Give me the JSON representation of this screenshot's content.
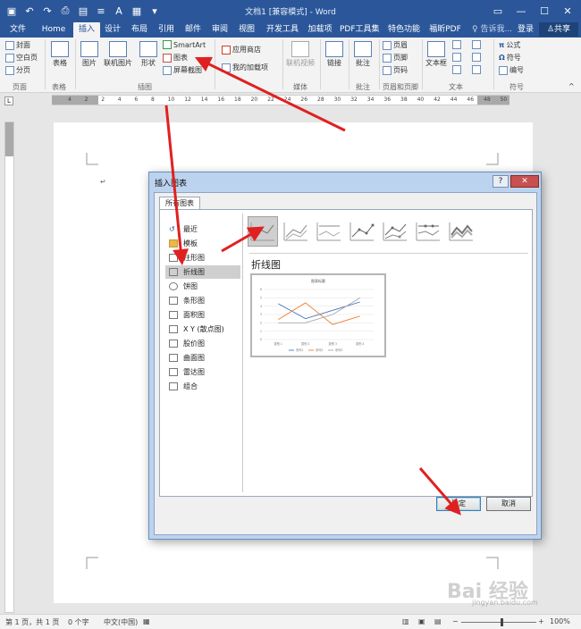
{
  "window": {
    "title": "文档1 [兼容模式] - Word"
  },
  "tabs": [
    {
      "label": "文件"
    },
    {
      "label": "Home"
    },
    {
      "label": "插入"
    },
    {
      "label": "设计"
    },
    {
      "label": "布局"
    },
    {
      "label": "引用"
    },
    {
      "label": "邮件"
    },
    {
      "label": "审阅"
    },
    {
      "label": "视图"
    },
    {
      "label": "开发工具"
    },
    {
      "label": "加载项"
    },
    {
      "label": "PDF工具集"
    },
    {
      "label": "特色功能"
    },
    {
      "label": "福昕PDF"
    }
  ],
  "tell_me": "告诉我...",
  "login": "登录",
  "share": "共享",
  "ribbon": {
    "cover": "封面",
    "blank": "空白页",
    "pagebreak": "分页",
    "table": "表格",
    "picture": "图片",
    "online_picture": "联机图片",
    "shapes": "形状",
    "smartart": "SmartArt",
    "chart": "图表",
    "screenshot": "屏幕截图",
    "store": "应用商店",
    "myaddins": "我的加载项",
    "online_video": "联机视频",
    "link": "链接",
    "comment": "批注",
    "header": "页眉",
    "footer": "页脚",
    "pagenum": "页码",
    "textbox": "文本框",
    "equation": "公式",
    "symbol": "符号",
    "numbering": "编号",
    "groups": {
      "pages": "页面",
      "tables": "表格",
      "illustrations": "插图",
      "media": "媒体",
      "comments": "批注",
      "header_footer": "页眉和页脚",
      "text": "文本",
      "symbols": "符号"
    }
  },
  "ruler": {
    "numbers": [
      "4",
      "2",
      "2",
      "4",
      "6",
      "8",
      "10",
      "12",
      "14",
      "16",
      "18",
      "20",
      "22",
      "24",
      "26",
      "28",
      "30",
      "32",
      "34",
      "36",
      "38",
      "40",
      "42",
      "44",
      "46",
      "48",
      "50"
    ]
  },
  "status": {
    "page": "第 1 页，共 1 页",
    "words": "0 个字",
    "lang": "中文(中国)",
    "zoom": "100%"
  },
  "dialog": {
    "title": "插入图表",
    "tab": "所有图表",
    "types": [
      "最近",
      "模板",
      "柱形图",
      "折线图",
      "饼图",
      "条形图",
      "面积图",
      "X Y (散点图)",
      "股价图",
      "曲面图",
      "雷达图",
      "组合"
    ],
    "selected_type": "折线图",
    "preview_title": "折线图",
    "ok": "确定",
    "cancel": "取消"
  },
  "chart_data": {
    "type": "line",
    "title": "图表标题",
    "categories": [
      "类别 1",
      "类别 2",
      "类别 3",
      "类别 4"
    ],
    "series": [
      {
        "name": "系列1",
        "values": [
          4.3,
          2.5,
          3.5,
          4.5
        ]
      },
      {
        "name": "系列2",
        "values": [
          2.4,
          4.4,
          1.8,
          2.8
        ]
      },
      {
        "name": "系列3",
        "values": [
          2.0,
          2.0,
          3.0,
          5.0
        ]
      }
    ],
    "ylim": [
      0,
      6
    ],
    "y_ticks": [
      "0",
      "1",
      "2",
      "3",
      "4",
      "5",
      "6"
    ],
    "colors": [
      "#4472c4",
      "#ed7d31",
      "#a5a5a5"
    ],
    "legend": "bottom"
  },
  "watermark": {
    "text": "Bai 经验",
    "sub": "jingyan.baidu.com"
  }
}
